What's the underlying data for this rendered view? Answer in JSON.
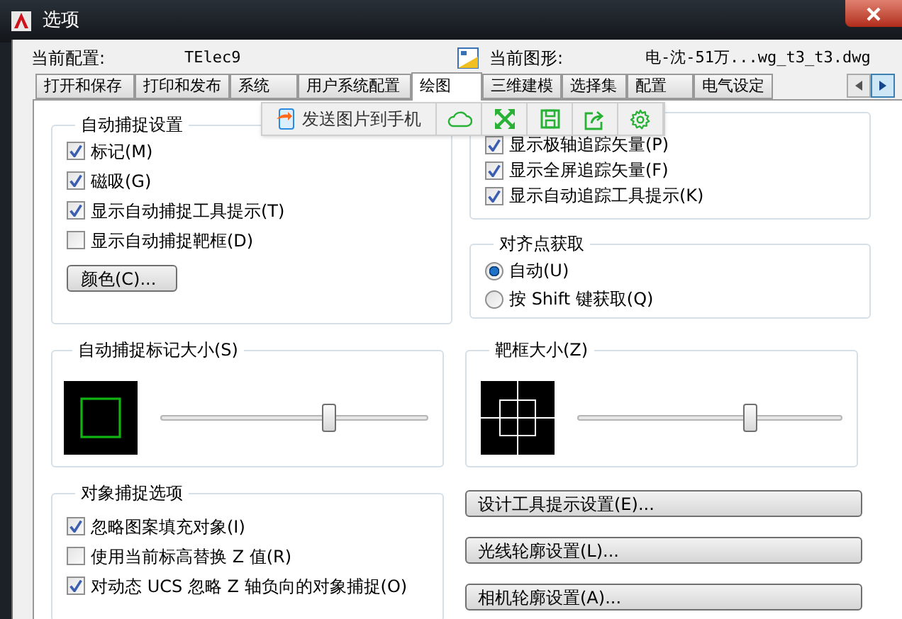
{
  "window": {
    "title": "选项"
  },
  "header": {
    "profile_label": "当前配置:",
    "profile": "TElec9",
    "drawing_label": "当前图形:",
    "drawing": "电-沈-51万...wg_t3_t3.dwg"
  },
  "tabs": [
    {
      "label": "打开和保存",
      "selected": false
    },
    {
      "label": "打印和发布",
      "selected": false
    },
    {
      "label": "系统",
      "selected": false
    },
    {
      "label": "用户系统配置",
      "selected": false
    },
    {
      "label": "绘图",
      "selected": true
    },
    {
      "label": "三维建模",
      "selected": false
    },
    {
      "label": "选择集",
      "selected": false
    },
    {
      "label": "配置",
      "selected": false
    },
    {
      "label": "电气设定",
      "selected": false
    }
  ],
  "floating_toolbar": {
    "send_label": "发送图片到手机"
  },
  "autosnap_settings": {
    "title": "自动捕捉设置",
    "options": [
      {
        "label": "标记(M)",
        "checked": true
      },
      {
        "label": "磁吸(G)",
        "checked": true
      },
      {
        "label": "显示自动捕捉工具提示(T)",
        "checked": true
      },
      {
        "label": "显示自动捕捉靶框(D)",
        "checked": false
      }
    ],
    "color_button": "颜色(C)..."
  },
  "autotrack_settings": {
    "options": [
      {
        "label": "显示极轴追踪矢量(P)",
        "checked": true
      },
      {
        "label": "显示全屏追踪矢量(F)",
        "checked": true
      },
      {
        "label": "显示自动追踪工具提示(K)",
        "checked": true
      }
    ]
  },
  "alignment_acquisition": {
    "title": "对齐点获取",
    "options": [
      {
        "label": "自动(U)",
        "selected": true
      },
      {
        "label": "按 Shift 键获取(Q)",
        "selected": false
      }
    ]
  },
  "autosnap_marker_size": {
    "title": "自动捕捉标记大小(S)",
    "level": 0.63
  },
  "aperture_size": {
    "title": "靶框大小(Z)",
    "level": 0.65
  },
  "object_snap_options": {
    "title": "对象捕捉选项",
    "options": [
      {
        "label": "忽略图案填充对象(I)",
        "checked": true
      },
      {
        "label": "使用当前标高替换 Z 值(R)",
        "checked": false
      },
      {
        "label": "对动态 UCS 忽略 Z 轴负向的对象捕捉(O)",
        "checked": true
      }
    ]
  },
  "buttons": [
    "设计工具提示设置(E)...",
    "光线轮廓设置(L)...",
    "相机轮廓设置(A)..."
  ]
}
